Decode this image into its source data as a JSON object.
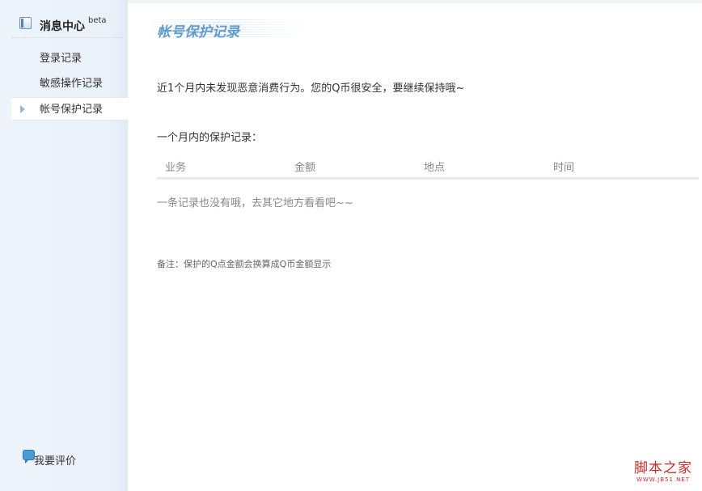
{
  "sidebar": {
    "header_title": "消息中心",
    "header_sup": "beta",
    "items": [
      {
        "label": "登录记录",
        "active": false
      },
      {
        "label": "敏感操作记录",
        "active": false
      },
      {
        "label": "帐号保护记录",
        "active": true
      }
    ],
    "feedback_label": "我要评价",
    "icons": {
      "header": "message-center-icon",
      "active_marker": "triangle-right-icon",
      "feedback": "chat-bubble-icon"
    }
  },
  "main": {
    "title": "帐号保护记录",
    "notice": "近1个月内未发现恶意消费行为。您的Q币很安全，要继续保持哦~",
    "records_title": "一个月内的保护记录：",
    "table": {
      "columns": [
        "业务",
        "金额",
        "地点",
        "时间"
      ],
      "rows": [],
      "empty_text": "一条记录也没有哦，去其它地方看看吧~~"
    },
    "remark": "备注：保护的Q点金额会换算成Q币金额显示"
  },
  "watermark": {
    "main": "脚本之家",
    "sub": "WWW.JB51.NET"
  },
  "colors": {
    "title": "#5f9bcd",
    "sidebar_bg": "#eaf1f9",
    "watermark": "#cc2a2a"
  }
}
